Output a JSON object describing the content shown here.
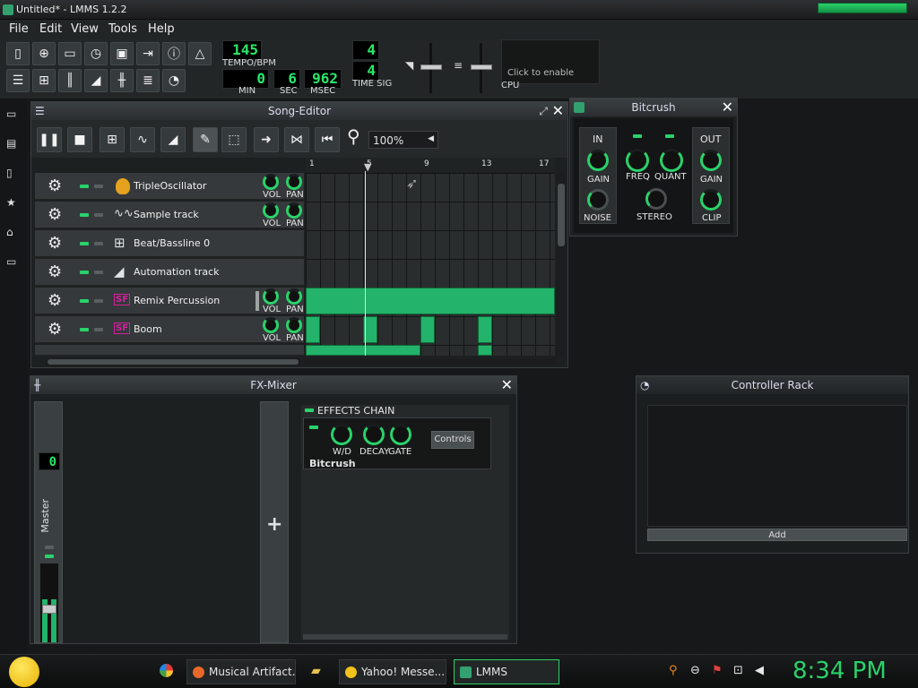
{
  "window": {
    "title": "Untitled* - LMMS 1.2.2"
  },
  "menu": [
    "File",
    "Edit",
    "View",
    "Tools",
    "Help"
  ],
  "transport": {
    "tempo": "145",
    "tempo_label": "TEMPO/BPM",
    "min": "0",
    "min_label": "MIN",
    "sec": "6",
    "sec_label": "SEC",
    "msec": "962",
    "msec_label": "MSEC",
    "timesig_top": "4",
    "timesig_bottom": "4",
    "timesig_label": "TIME SIG",
    "cpu_hint": "Click to enable",
    "cpu_label": "CPU"
  },
  "song_editor": {
    "title": "Song-Editor",
    "zoom": "100%",
    "bar_markers": [
      "1",
      "5",
      "9",
      "13",
      "17"
    ],
    "tracks": [
      {
        "name": "TripleOscillator",
        "icon": "triple-oscillator-icon",
        "has_knobs": true
      },
      {
        "name": "Sample track",
        "icon": "waveform-icon",
        "has_knobs": true
      },
      {
        "name": "Beat/Bassline 0",
        "icon": "beat-bassline-icon",
        "has_knobs": false
      },
      {
        "name": "Automation track",
        "icon": "automation-icon",
        "has_knobs": false
      },
      {
        "name": "Remix Percussion",
        "icon": "sf2-player-icon",
        "has_knobs": true
      },
      {
        "name": "Boom",
        "icon": "sf2-player-icon",
        "has_knobs": true
      }
    ],
    "vol_label": "VOL",
    "pan_label": "PAN"
  },
  "bitcrush": {
    "title": "Bitcrush",
    "in_label": "IN",
    "out_label": "OUT",
    "knobs": [
      "GAIN",
      "FREQ",
      "QUANT",
      "GAIN",
      "NOISE",
      "STEREO",
      "CLIP"
    ]
  },
  "fx_mixer": {
    "title": "FX-Mixer",
    "channel": "Master",
    "channel_lcd": "0",
    "add_symbol": "+",
    "effects_chain_label": "EFFECTS CHAIN",
    "effect_name": "Bitcrush",
    "effect_knobs": [
      "W/D",
      "DECAY",
      "GATE"
    ],
    "controls_button": "Controls"
  },
  "controller_rack": {
    "title": "Controller Rack",
    "add_button": "Add"
  },
  "taskbar": {
    "tasks": [
      "Musical Artifact...",
      "Yahoo! Messe...",
      "LMMS"
    ],
    "clock": "8:34 PM"
  },
  "colors": {
    "accent_green": "#23b36a",
    "lcd_green": "#28e868",
    "sf2_magenta": "#d4219b"
  }
}
